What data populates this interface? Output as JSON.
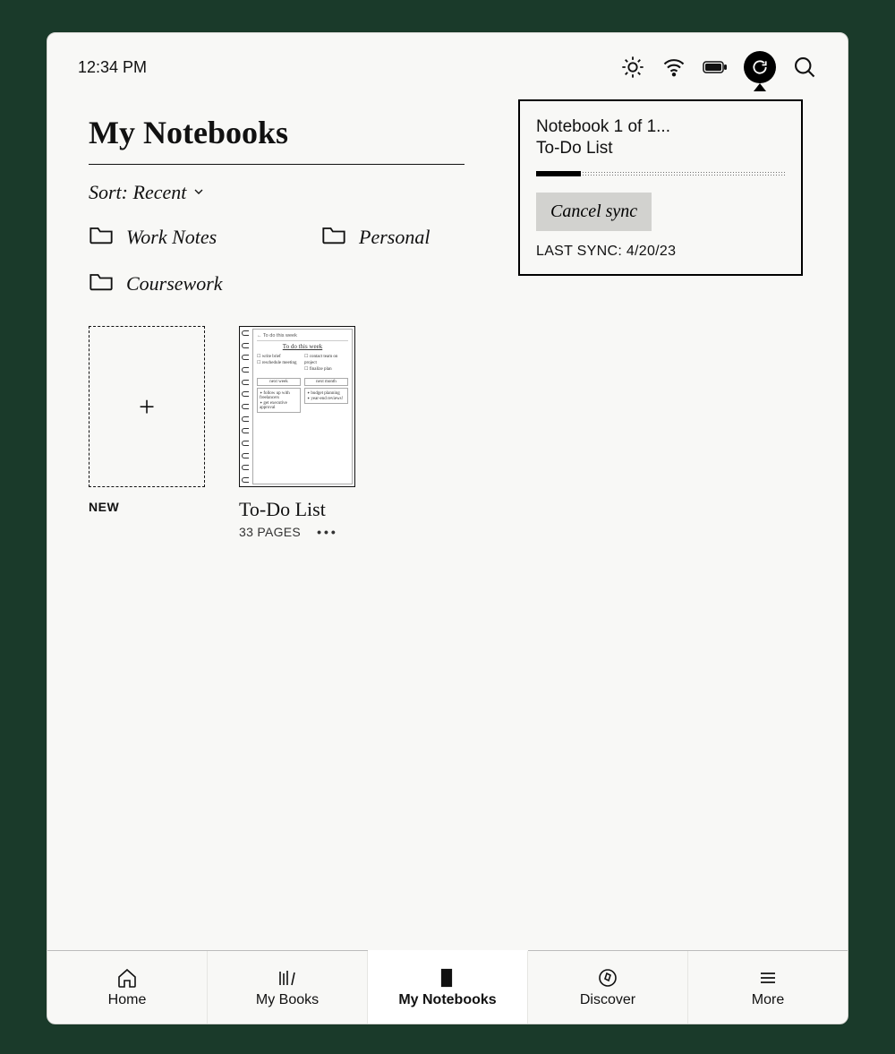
{
  "statusbar": {
    "time": "12:34 PM"
  },
  "header": {
    "title": "My Notebooks"
  },
  "sort": {
    "label": "Sort: Recent"
  },
  "folders": [
    {
      "name": "Work Notes"
    },
    {
      "name": "Personal"
    },
    {
      "name": "Coursework"
    }
  ],
  "new_tile": {
    "label": "NEW"
  },
  "notebooks": [
    {
      "title": "To-Do List",
      "pages_label": "33 PAGES",
      "thumb": {
        "back": "← To do this week",
        "heading": "To do this week",
        "left_items": [
          "write brief",
          "reschedule meeting"
        ],
        "right_items": [
          "contact team on project",
          "finalize plan"
        ],
        "box_left_h": "next week",
        "box_right_h": "next month",
        "box_left": [
          "follow up with freelancers",
          "get executive approval"
        ],
        "box_right": [
          "budget planning",
          "year-end reviews!"
        ]
      }
    }
  ],
  "sync_popover": {
    "status_line": "Notebook 1 of 1...",
    "item_name": "To-Do List",
    "cancel_label": "Cancel sync",
    "last_sync": "LAST SYNC: 4/20/23"
  },
  "tabs": [
    {
      "label": "Home"
    },
    {
      "label": "My Books"
    },
    {
      "label": "My Notebooks"
    },
    {
      "label": "Discover"
    },
    {
      "label": "More"
    }
  ]
}
